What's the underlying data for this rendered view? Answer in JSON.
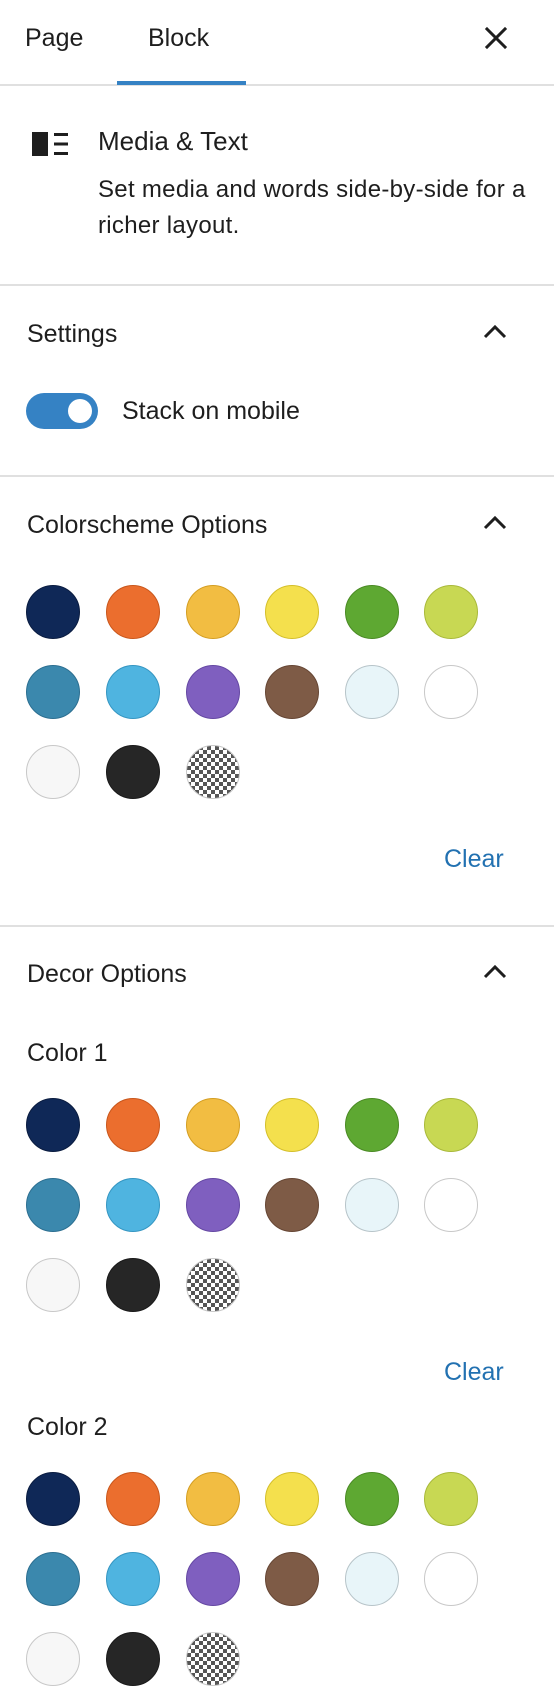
{
  "tabs": {
    "page": "Page",
    "block": "Block"
  },
  "block": {
    "title": "Media & Text",
    "description": "Set media and words side-by-side for a richer layout."
  },
  "settings": {
    "heading": "Settings",
    "toggle_label": "Stack on mobile",
    "toggle_on": true
  },
  "colorscheme": {
    "heading": "Colorscheme Options",
    "clear": "Clear"
  },
  "decor": {
    "heading": "Decor Options",
    "color1_label": "Color 1",
    "color1_clear": "Clear",
    "color2_label": "Color 2"
  },
  "palette": [
    "#0f2857",
    "#eb6e2e",
    "#f2bd42",
    "#f4e04d",
    "#5ea832",
    "#c8d853",
    "#3b88ad",
    "#4fb4e0",
    "#7f5fbf",
    "#7e5b46",
    "#e8f5f9",
    "#ffffff",
    "#f7f7f7",
    "#262626",
    "transparent"
  ],
  "colors": {
    "accent": "#3582c4",
    "link": "#2271b1",
    "divider": "#e0e0e0"
  }
}
